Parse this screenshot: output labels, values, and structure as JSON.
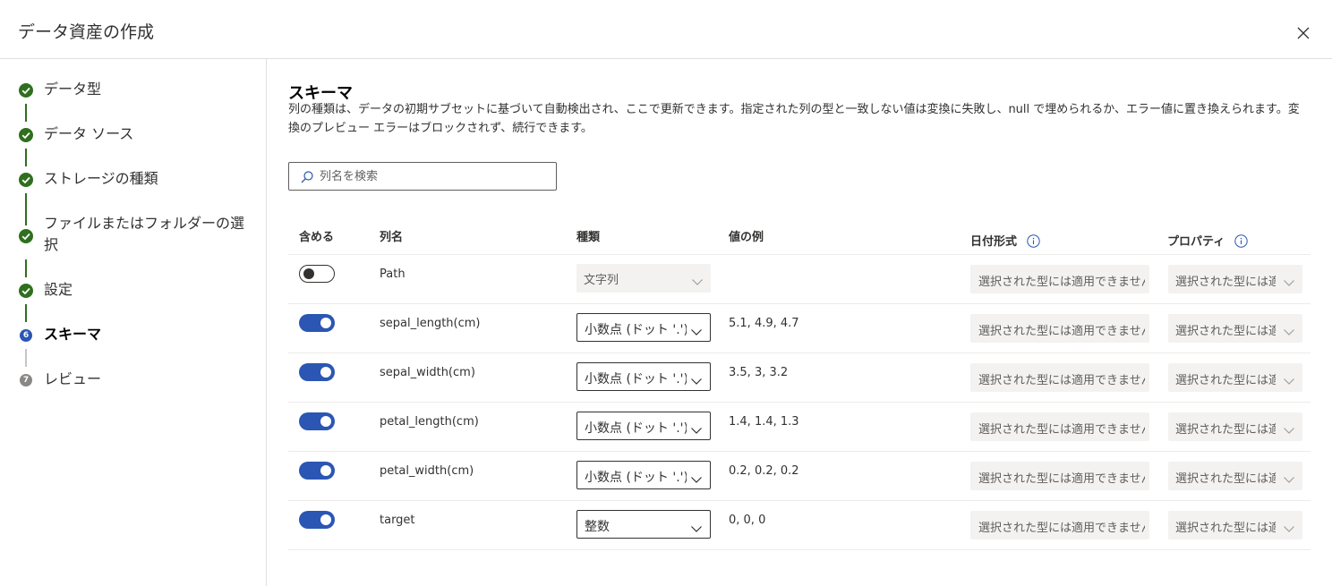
{
  "header": {
    "title": "データ資産の作成"
  },
  "steps": [
    {
      "label": "データ型",
      "state": "done"
    },
    {
      "label": "データ ソース",
      "state": "done"
    },
    {
      "label": "ストレージの種類",
      "state": "done"
    },
    {
      "label": "ファイルまたはフォルダーの選択",
      "state": "done"
    },
    {
      "label": "設定",
      "state": "done"
    },
    {
      "label": "スキーマ",
      "state": "current",
      "number": "6"
    },
    {
      "label": "レビュー",
      "state": "pending",
      "number": "7"
    }
  ],
  "schema": {
    "title": "スキーマ",
    "description": "列の種類は、データの初期サブセットに基づいて自動検出され、ここで更新できます。指定された列の型と一致しない値は変換に失敗し、null で埋められるか、エラー値に置き換えられます。変換のプレビュー エラーはブロックされず、続行できます。",
    "search_placeholder": "列名を検索",
    "columns": {
      "include": "含める",
      "name": "列名",
      "type": "種類",
      "example": "値の例",
      "date_format": "日付形式",
      "properties": "プロパティ"
    },
    "rows": [
      {
        "include": false,
        "name": "Path",
        "type": "文字列",
        "type_disabled": true,
        "example": "",
        "date_format": "選択された型には適用できません",
        "properties": "選択された型には適用できません"
      },
      {
        "include": true,
        "name": "sepal_length(cm)",
        "type": "小数点 (ドット '.')",
        "type_disabled": false,
        "example": "5.1, 4.9, 4.7",
        "date_format": "選択された型には適用できません",
        "properties": "選択された型には適用できません"
      },
      {
        "include": true,
        "name": "sepal_width(cm)",
        "type": "小数点 (ドット '.')",
        "type_disabled": false,
        "example": "3.5, 3, 3.2",
        "date_format": "選択された型には適用できません",
        "properties": "選択された型には適用できません"
      },
      {
        "include": true,
        "name": "petal_length(cm)",
        "type": "小数点 (ドット '.')",
        "type_disabled": false,
        "example": "1.4, 1.4, 1.3",
        "date_format": "選択された型には適用できません",
        "properties": "選択された型には適用できません"
      },
      {
        "include": true,
        "name": "petal_width(cm)",
        "type": "小数点 (ドット '.')",
        "type_disabled": false,
        "example": "0.2, 0.2, 0.2",
        "date_format": "選択された型には適用できません",
        "properties": "選択された型には適用できません"
      },
      {
        "include": true,
        "name": "target",
        "type": "整数",
        "type_disabled": false,
        "example": "0, 0, 0",
        "date_format": "選択された型には適用できません",
        "properties": "選択された型には適用できません"
      }
    ]
  },
  "colors": {
    "accent": "#2b56b3",
    "success": "#2f6f1f",
    "pending": "#8a8886"
  }
}
